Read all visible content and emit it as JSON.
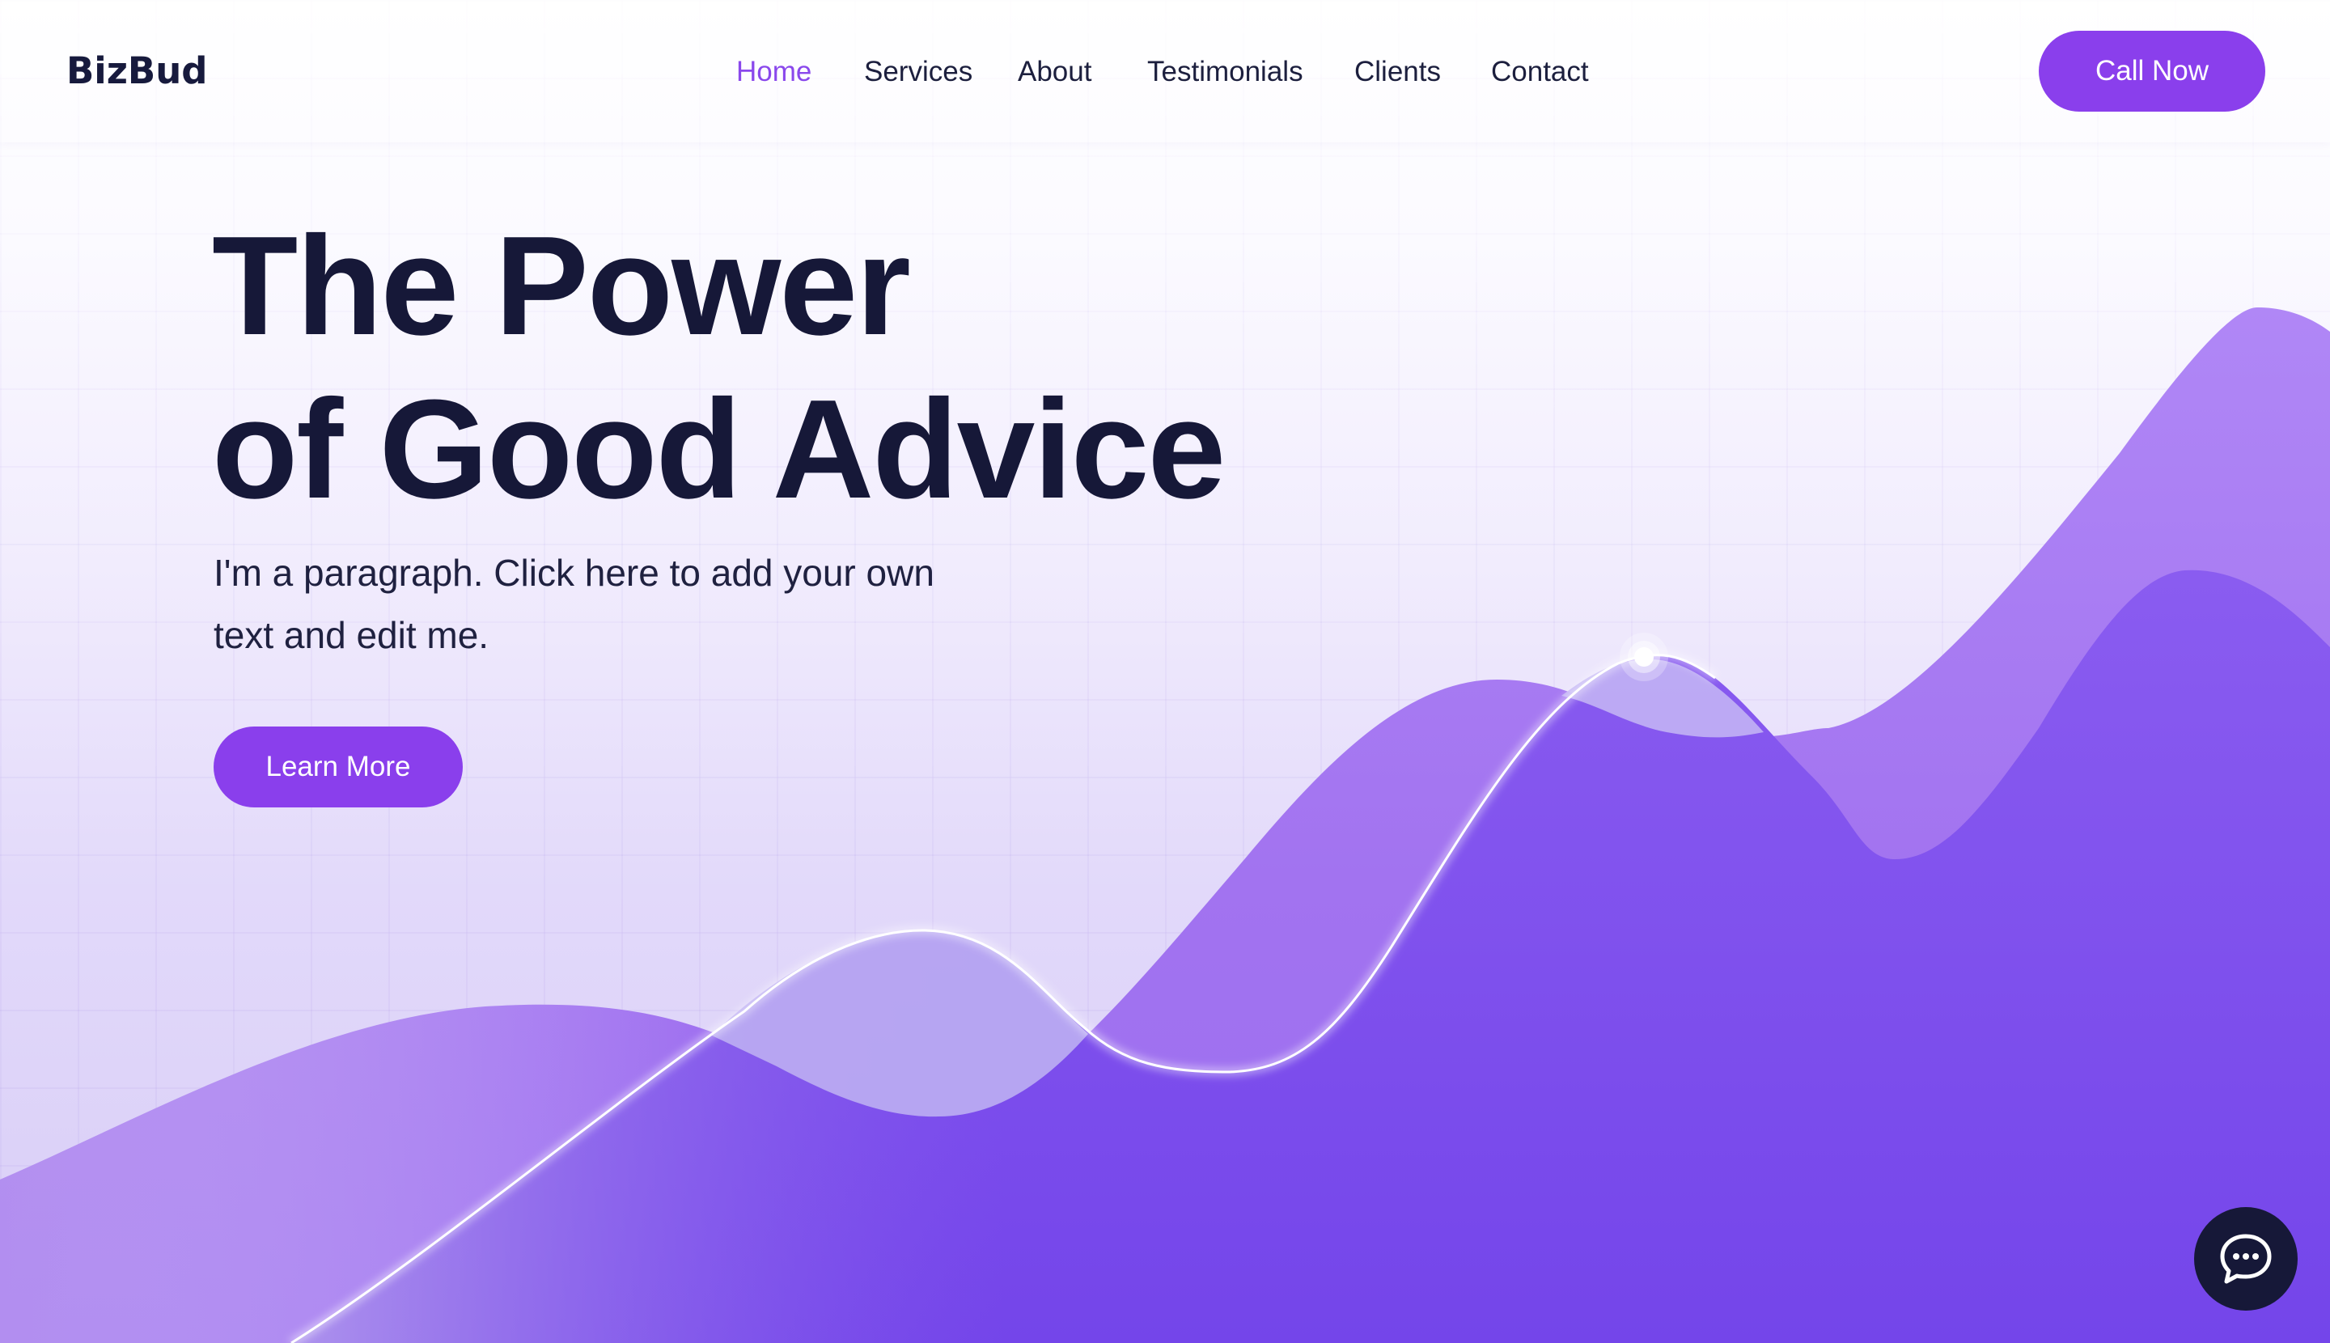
{
  "header": {
    "logo": "BizBud",
    "nav": [
      {
        "label": "Home",
        "active": true
      },
      {
        "label": "Services",
        "active": false
      },
      {
        "label": "About",
        "active": false
      },
      {
        "label": "Testimonials",
        "active": false
      },
      {
        "label": "Clients",
        "active": false
      },
      {
        "label": "Contact",
        "active": false
      }
    ],
    "cta_label": "Call Now"
  },
  "hero": {
    "title_line1": "The Power",
    "title_line2": "of Good Advice",
    "paragraph": "I'm a paragraph. Click here to add your own text and edit me.",
    "button_label": "Learn More"
  },
  "chat": {
    "icon": "chat-bubble-icon"
  },
  "colors": {
    "accent": "#8a3fec",
    "nav_active": "#8a48ec",
    "heading": "#161838",
    "chat_button": "#161838",
    "wave_back": "#a77df3",
    "wave_front": "#7b4be9",
    "overlap": "#b6a6f1"
  }
}
